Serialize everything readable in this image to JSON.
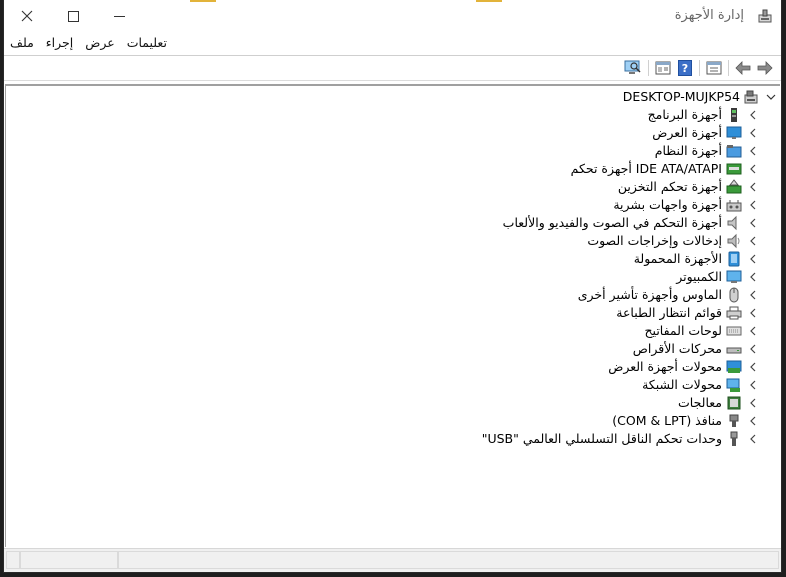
{
  "window": {
    "title": "إدارة الأجهزة",
    "controls": {
      "close_icon": "close-icon",
      "maximize_icon": "maximize-icon",
      "minimize_icon": "minimize-icon"
    }
  },
  "menu": {
    "items": [
      "ملف",
      "إجراء",
      "عرض",
      "تعليمات"
    ]
  },
  "toolbar": {
    "buttons": [
      "forward-icon",
      "back-icon",
      "properties-icon",
      "help-icon",
      "show-hide-tree-icon",
      "scan-hardware-icon"
    ]
  },
  "tree": {
    "root": {
      "label": "DESKTOP-MUJKP54",
      "expanded": true
    },
    "items": [
      {
        "label": "أجهزة البرنامج",
        "icon": "software-device-icon"
      },
      {
        "label": "أجهزة العرض",
        "icon": "monitor-icon"
      },
      {
        "label": "أجهزة النظام",
        "icon": "system-device-icon"
      },
      {
        "label": "IDE ATA/ATAPI أجهزة تحكم",
        "icon": "ide-controller-icon"
      },
      {
        "label": "أجهزة تحكم التخزين",
        "icon": "storage-controller-icon"
      },
      {
        "label": "أجهزة واجهات بشرية",
        "icon": "hid-icon"
      },
      {
        "label": "أجهزة التحكم في الصوت والفيديو والألعاب",
        "icon": "sound-icon"
      },
      {
        "label": "إدخالات وإخراجات الصوت",
        "icon": "speaker-icon"
      },
      {
        "label": "الأجهزة المحمولة",
        "icon": "portable-device-icon"
      },
      {
        "label": "الكمبيوتر",
        "icon": "computer-icon"
      },
      {
        "label": "الماوس وأجهزة تأشير أخرى",
        "icon": "mouse-icon"
      },
      {
        "label": "قوائم انتظار الطباعة",
        "icon": "printer-icon"
      },
      {
        "label": "لوحات المفاتيح",
        "icon": "keyboard-icon"
      },
      {
        "label": "محركات الأقراص",
        "icon": "disk-drive-icon"
      },
      {
        "label": "محولات أجهزة العرض",
        "icon": "display-adapter-icon"
      },
      {
        "label": "محولات الشبكة",
        "icon": "network-adapter-icon"
      },
      {
        "label": "معالجات",
        "icon": "processor-icon"
      },
      {
        "label": "منافذ (COM & LPT)",
        "icon": "port-icon"
      },
      {
        "label": "وحدات تحكم الناقل التسلسلي العالمي \"USB\"",
        "icon": "usb-icon"
      }
    ]
  },
  "colors": {
    "accent": "#e2b33a",
    "monitor_blue": "#2f8fd8",
    "green": "#3a9a3a"
  }
}
